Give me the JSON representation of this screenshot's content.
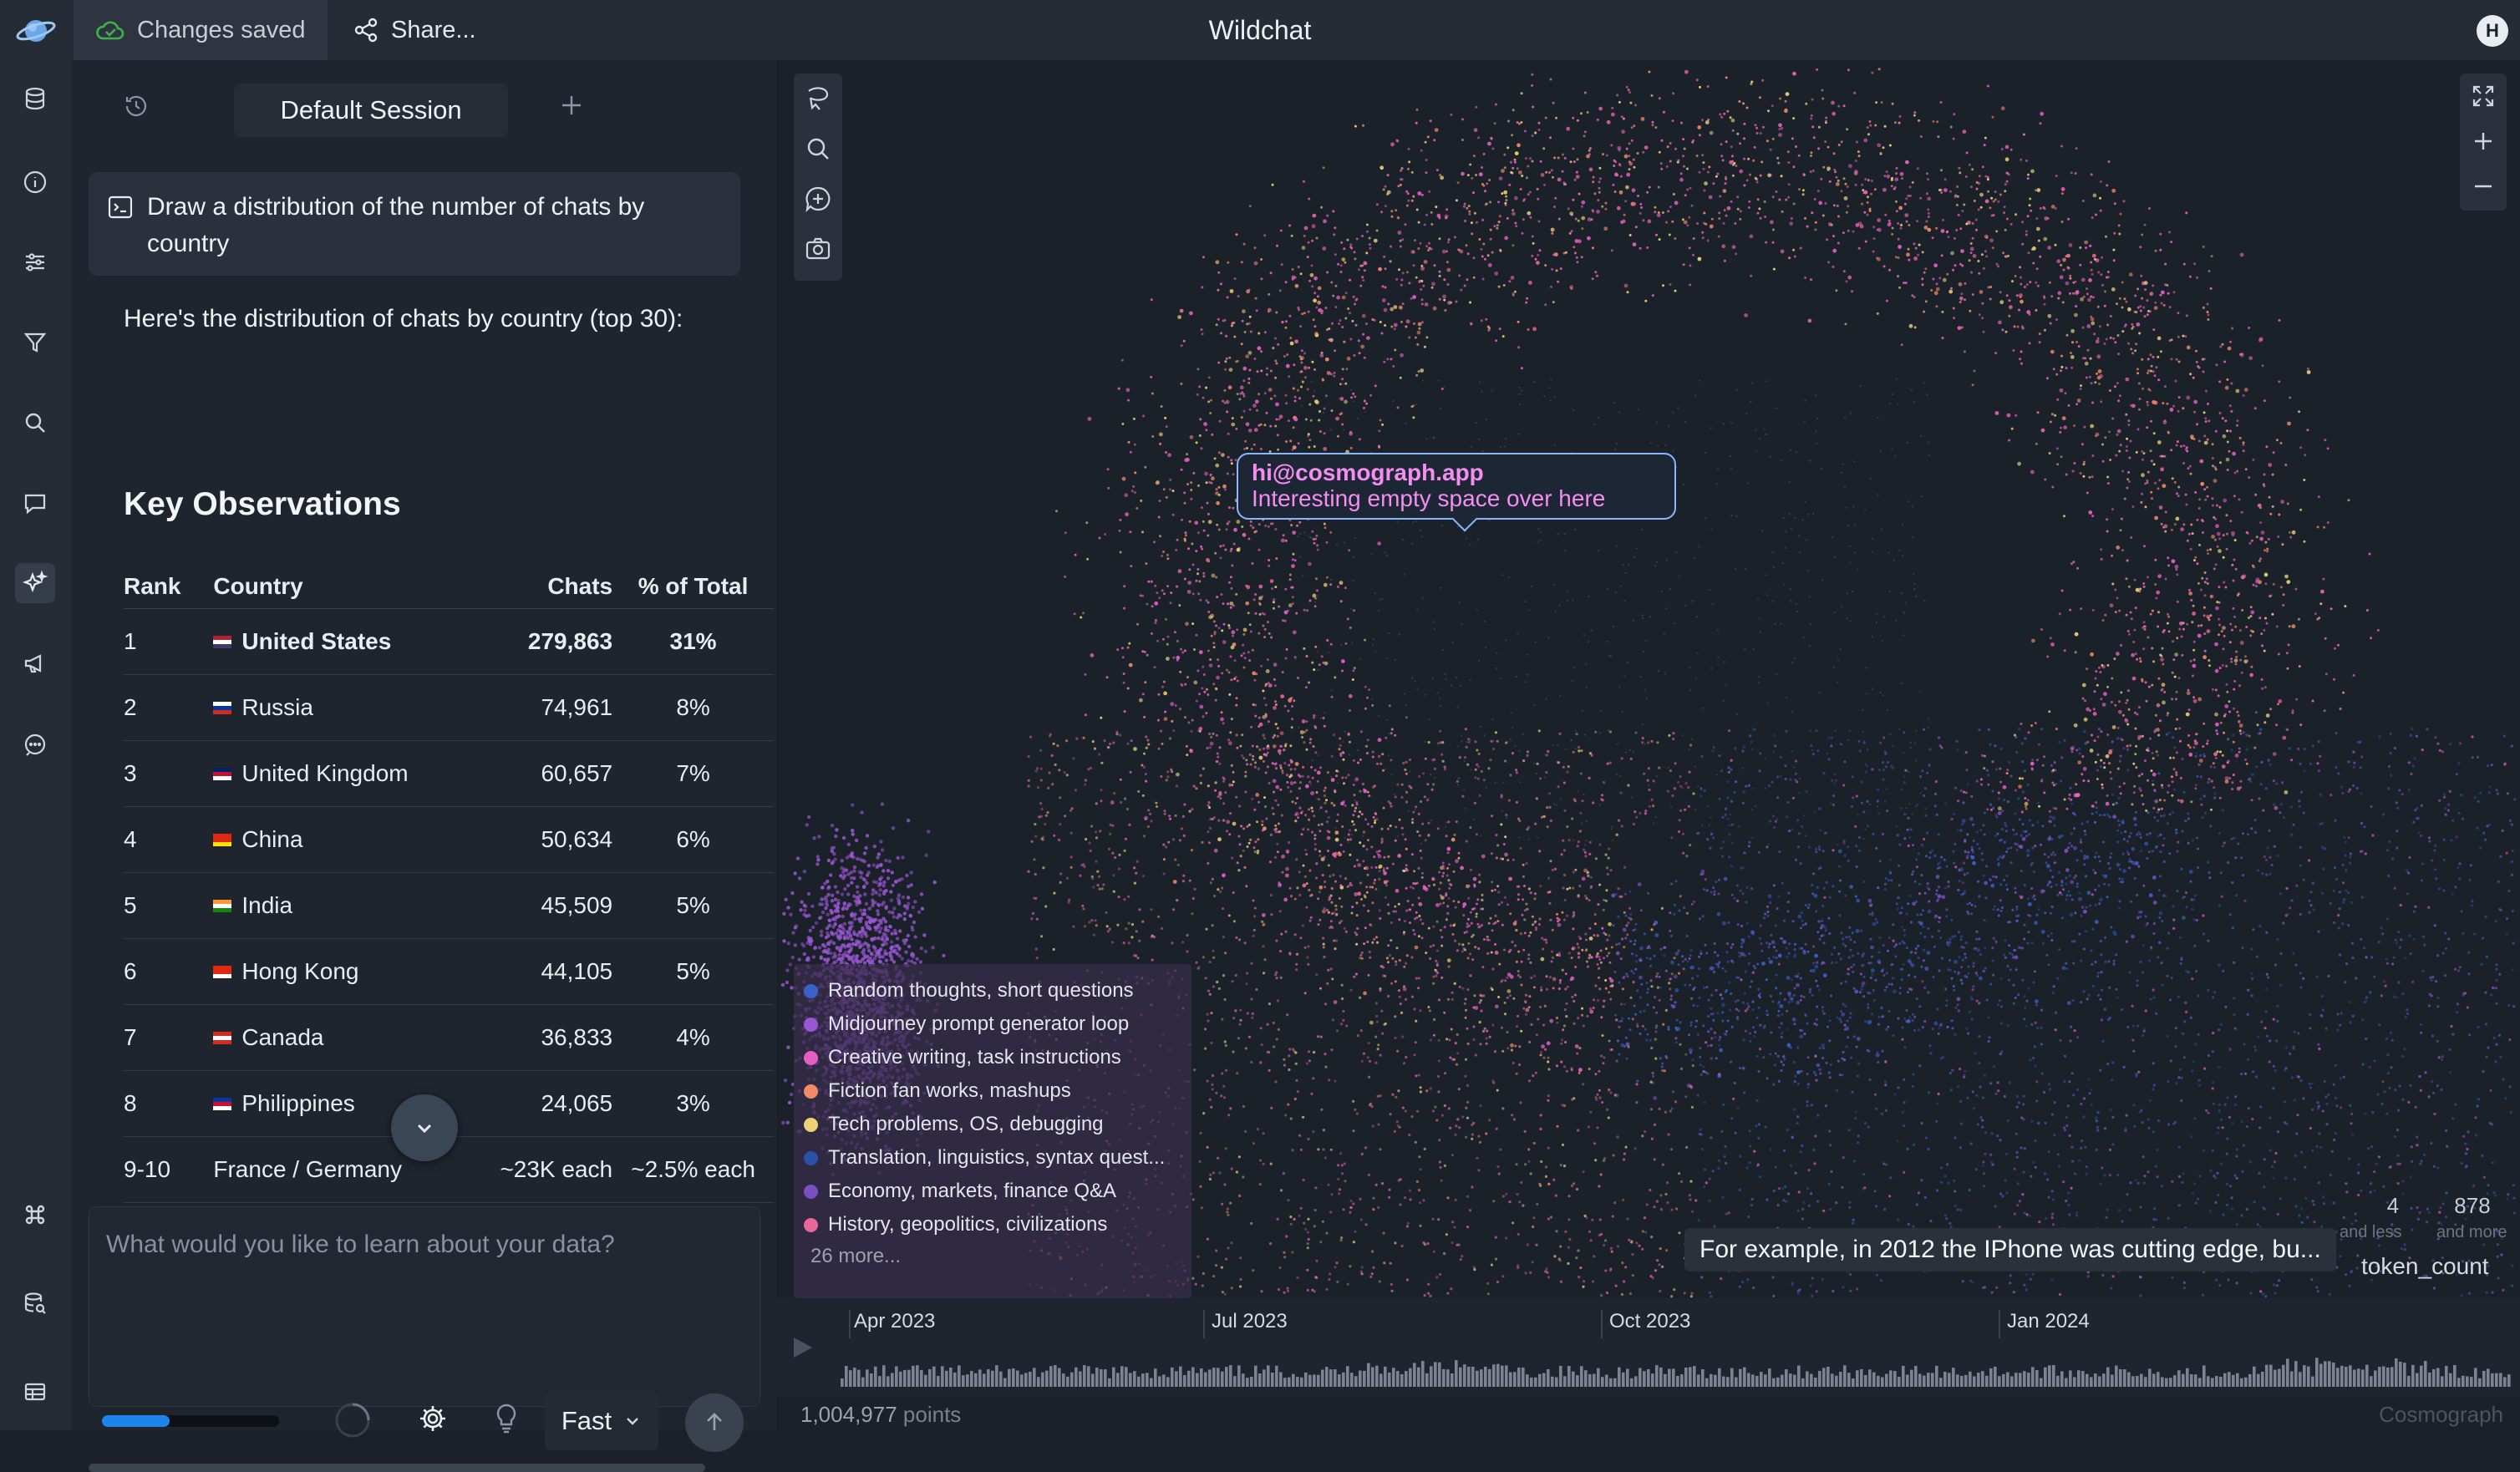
{
  "app": {
    "title": "Wildchat",
    "status_label": "Changes saved",
    "share_label": "Share...",
    "user_initial": "H"
  },
  "rail": {
    "icons": [
      "database-icon",
      "info-icon",
      "sliders-icon",
      "filter-icon",
      "search-icon",
      "comment-icon",
      "sparkles-icon",
      "megaphone-icon",
      "chat-bubble-icon",
      "command-icon",
      "database-search-icon",
      "table-icon"
    ],
    "active": "sparkles-icon"
  },
  "chat": {
    "session_name": "Default Session",
    "prompt": "Draw a distribution of the number of chats by country",
    "answer_intro": "Here's the distribution of chats by country (top 30):",
    "observations_heading": "Key Observations",
    "table": {
      "headers": [
        "Rank",
        "Country",
        "Chats",
        "% of Total"
      ],
      "rows": [
        {
          "rank": "1",
          "flag": "us",
          "country": "United States",
          "chats": "279,863",
          "pct": "31%",
          "bold": true
        },
        {
          "rank": "2",
          "flag": "ru",
          "country": "Russia",
          "chats": "74,961",
          "pct": "8%"
        },
        {
          "rank": "3",
          "flag": "gb",
          "country": "United Kingdom",
          "chats": "60,657",
          "pct": "7%"
        },
        {
          "rank": "4",
          "flag": "cn",
          "country": "China",
          "chats": "50,634",
          "pct": "6%"
        },
        {
          "rank": "5",
          "flag": "in",
          "country": "India",
          "chats": "45,509",
          "pct": "5%"
        },
        {
          "rank": "6",
          "flag": "hk",
          "country": "Hong Kong",
          "chats": "44,105",
          "pct": "5%"
        },
        {
          "rank": "7",
          "flag": "ca",
          "country": "Canada",
          "chats": "36,833",
          "pct": "4%"
        },
        {
          "rank": "8",
          "flag": "ph",
          "country": "Philippines",
          "chats": "24,065",
          "pct": "3%"
        },
        {
          "rank": "9-10",
          "flag": "",
          "country": "France / Germany",
          "chats": "~23K each",
          "pct": "~2.5% each"
        }
      ]
    },
    "input_placeholder": "What would you like to learn about your data?",
    "progress": 0.38,
    "mode": "Fast"
  },
  "graph": {
    "annotation": {
      "email": "hi@cosmograph.app",
      "note": "Interesting empty space over here"
    },
    "legend": [
      {
        "label": "Random thoughts, short questions",
        "color": "#3b62c9"
      },
      {
        "label": "Midjourney prompt generator loop",
        "color": "#9b56d6"
      },
      {
        "label": "Creative writing, task instructions",
        "color": "#e45fc4"
      },
      {
        "label": "Fiction fan works, mashups",
        "color": "#f08a6a"
      },
      {
        "label": "Tech problems, OS, debugging",
        "color": "#ecd07a"
      },
      {
        "label": "Translation, linguistics, syntax quest...",
        "color": "#2c4fa8"
      },
      {
        "label": "Economy, markets, finance Q&A",
        "color": "#7a4fc4"
      },
      {
        "label": "History, geopolitics, civilizations",
        "color": "#e8689a"
      }
    ],
    "legend_more": "26 more...",
    "hover_label": "For example, in 2012 the IPhone was cutting edge, bu...",
    "size_legend": {
      "min": "4",
      "max": "878",
      "min_sub": "and less",
      "max_sub": "and more",
      "field": "token_count"
    }
  },
  "timeline": {
    "labels": [
      "Apr 2023",
      "Jul 2023",
      "Oct 2023",
      "Jan 2024"
    ]
  },
  "footer": {
    "point_count": "1,004,977",
    "point_unit": "points",
    "brand": "Cosmograph"
  }
}
